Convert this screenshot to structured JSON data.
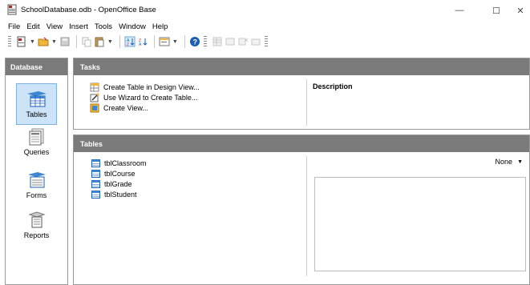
{
  "window": {
    "title": "SchoolDatabase.odb - OpenOffice Base",
    "minimize": "—",
    "maximize": "☐",
    "close": "✕"
  },
  "menu": [
    "File",
    "Edit",
    "View",
    "Insert",
    "Tools",
    "Window",
    "Help"
  ],
  "database_panel": {
    "header": "Database",
    "items": [
      {
        "label": "Tables",
        "selected": true
      },
      {
        "label": "Queries",
        "selected": false
      },
      {
        "label": "Forms",
        "selected": false
      },
      {
        "label": "Reports",
        "selected": false
      }
    ]
  },
  "tasks": {
    "header": "Tasks",
    "items": [
      "Create Table in Design View...",
      "Use Wizard to Create Table...",
      "Create View..."
    ],
    "description_label": "Description"
  },
  "tables": {
    "header": "Tables",
    "items": [
      "tblClassroom",
      "tblCourse",
      "tblGrade",
      "tblStudent"
    ],
    "preview_mode": "None"
  },
  "colors": {
    "panel_header": "#7a7a7a",
    "selection": "#cde3f7"
  }
}
